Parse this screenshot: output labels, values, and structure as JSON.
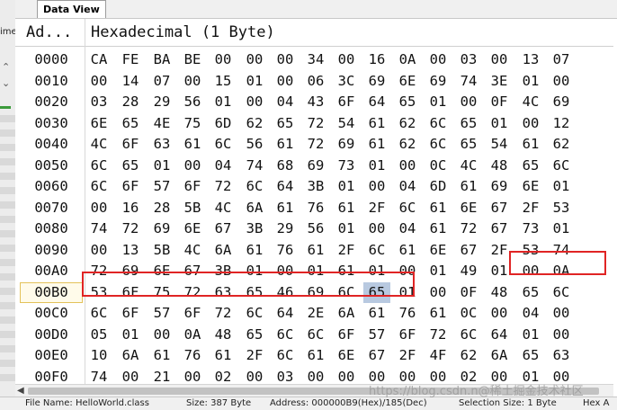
{
  "left_strip": {
    "snippet": "ime"
  },
  "tabs": [
    {
      "label": "Data View"
    }
  ],
  "header": {
    "address": "Ad...",
    "hex": "Hexadecimal (1 Byte)"
  },
  "rows": [
    {
      "address": "0000",
      "bytes": [
        "CA",
        "FE",
        "BA",
        "BE",
        "00",
        "00",
        "00",
        "34",
        "00",
        "16",
        "0A",
        "00",
        "03",
        "00",
        "13",
        "07"
      ]
    },
    {
      "address": "0010",
      "bytes": [
        "00",
        "14",
        "07",
        "00",
        "15",
        "01",
        "00",
        "06",
        "3C",
        "69",
        "6E",
        "69",
        "74",
        "3E",
        "01",
        "00"
      ]
    },
    {
      "address": "0020",
      "bytes": [
        "03",
        "28",
        "29",
        "56",
        "01",
        "00",
        "04",
        "43",
        "6F",
        "64",
        "65",
        "01",
        "00",
        "0F",
        "4C",
        "69"
      ]
    },
    {
      "address": "0030",
      "bytes": [
        "6E",
        "65",
        "4E",
        "75",
        "6D",
        "62",
        "65",
        "72",
        "54",
        "61",
        "62",
        "6C",
        "65",
        "01",
        "00",
        "12"
      ]
    },
    {
      "address": "0040",
      "bytes": [
        "4C",
        "6F",
        "63",
        "61",
        "6C",
        "56",
        "61",
        "72",
        "69",
        "61",
        "62",
        "6C",
        "65",
        "54",
        "61",
        "62"
      ]
    },
    {
      "address": "0050",
      "bytes": [
        "6C",
        "65",
        "01",
        "00",
        "04",
        "74",
        "68",
        "69",
        "73",
        "01",
        "00",
        "0C",
        "4C",
        "48",
        "65",
        "6C"
      ]
    },
    {
      "address": "0060",
      "bytes": [
        "6C",
        "6F",
        "57",
        "6F",
        "72",
        "6C",
        "64",
        "3B",
        "01",
        "00",
        "04",
        "6D",
        "61",
        "69",
        "6E",
        "01"
      ]
    },
    {
      "address": "0070",
      "bytes": [
        "00",
        "16",
        "28",
        "5B",
        "4C",
        "6A",
        "61",
        "76",
        "61",
        "2F",
        "6C",
        "61",
        "6E",
        "67",
        "2F",
        "53"
      ]
    },
    {
      "address": "0080",
      "bytes": [
        "74",
        "72",
        "69",
        "6E",
        "67",
        "3B",
        "29",
        "56",
        "01",
        "00",
        "04",
        "61",
        "72",
        "67",
        "73",
        "01"
      ]
    },
    {
      "address": "0090",
      "bytes": [
        "00",
        "13",
        "5B",
        "4C",
        "6A",
        "61",
        "76",
        "61",
        "2F",
        "6C",
        "61",
        "6E",
        "67",
        "2F",
        "53",
        "74"
      ]
    },
    {
      "address": "00A0",
      "bytes": [
        "72",
        "69",
        "6E",
        "67",
        "3B",
        "01",
        "00",
        "01",
        "61",
        "01",
        "00",
        "01",
        "49",
        "01",
        "00",
        "0A"
      ]
    },
    {
      "address": "00B0",
      "bytes": [
        "53",
        "6F",
        "75",
        "72",
        "63",
        "65",
        "46",
        "69",
        "6C",
        "65",
        "01",
        "00",
        "0F",
        "48",
        "65",
        "6C"
      ]
    },
    {
      "address": "00C0",
      "bytes": [
        "6C",
        "6F",
        "57",
        "6F",
        "72",
        "6C",
        "64",
        "2E",
        "6A",
        "61",
        "76",
        "61",
        "0C",
        "00",
        "04",
        "00"
      ]
    },
    {
      "address": "00D0",
      "bytes": [
        "05",
        "01",
        "00",
        "0A",
        "48",
        "65",
        "6C",
        "6C",
        "6F",
        "57",
        "6F",
        "72",
        "6C",
        "64",
        "01",
        "00"
      ]
    },
    {
      "address": "00E0",
      "bytes": [
        "10",
        "6A",
        "61",
        "76",
        "61",
        "2F",
        "6C",
        "61",
        "6E",
        "67",
        "2F",
        "4F",
        "62",
        "6A",
        "65",
        "63"
      ]
    },
    {
      "address": "00F0",
      "bytes": [
        "74",
        "00",
        "21",
        "00",
        "02",
        "00",
        "03",
        "00",
        "00",
        "00",
        "00",
        "00",
        "02",
        "00",
        "01",
        "00"
      ]
    }
  ],
  "current_row": 11,
  "selected_byte": {
    "row": 11,
    "col": 9
  },
  "highlights": [
    {
      "row": 10,
      "from_col": 13,
      "to_col": 15,
      "color": "#e02424"
    },
    {
      "row": 11,
      "from_col": 0,
      "to_col": 9,
      "color": "#e02424"
    }
  ],
  "status_bar": {
    "file": "File Name: HelloWorld.class",
    "size": "Size: 387 Byte",
    "address": "Address: 000000B9(Hex)/185(Dec)",
    "selection": "Selection Size: 1 Byte",
    "last": "Hex A"
  },
  "watermark": "https://blog.csdn.n@稀土掘金技术社区"
}
